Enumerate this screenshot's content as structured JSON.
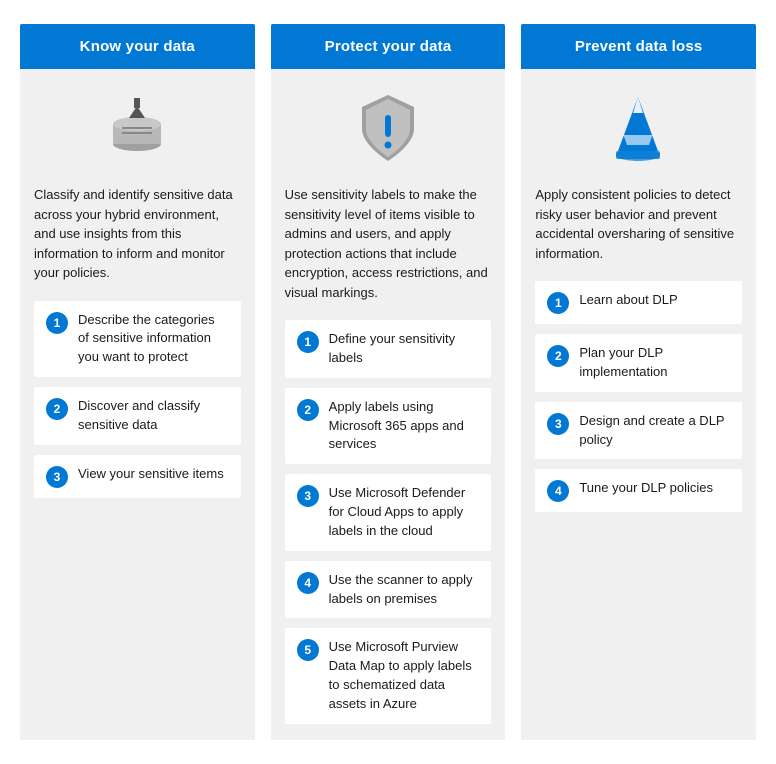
{
  "columns": [
    {
      "id": "know-your-data",
      "header": "Know your data",
      "description": "Classify and identify sensitive data across your hybrid environment, and use insights from this information to inform and monitor your policies.",
      "steps": [
        "Describe the categories of sensitive information you want to protect",
        "Discover and classify sensitive data",
        "View your sensitive items"
      ]
    },
    {
      "id": "protect-your-data",
      "header": "Protect your data",
      "description": "Use sensitivity labels to make the sensitivity level of items visible to admins and users, and apply protection actions that include encryption, access restrictions, and visual markings.",
      "steps": [
        "Define your sensitivity labels",
        "Apply labels using Microsoft 365 apps and services",
        "Use Microsoft Defender for Cloud Apps to apply labels in the cloud",
        "Use the scanner to apply labels on premises",
        "Use Microsoft Purview Data Map to apply labels to schematized data assets in Azure"
      ]
    },
    {
      "id": "prevent-data-loss",
      "header": "Prevent data loss",
      "description": "Apply consistent policies to detect risky user behavior and prevent accidental oversharing of sensitive information.",
      "steps": [
        "Learn about DLP",
        "Plan your DLP implementation",
        "Design and create a DLP policy",
        "Tune your DLP policies"
      ]
    }
  ]
}
